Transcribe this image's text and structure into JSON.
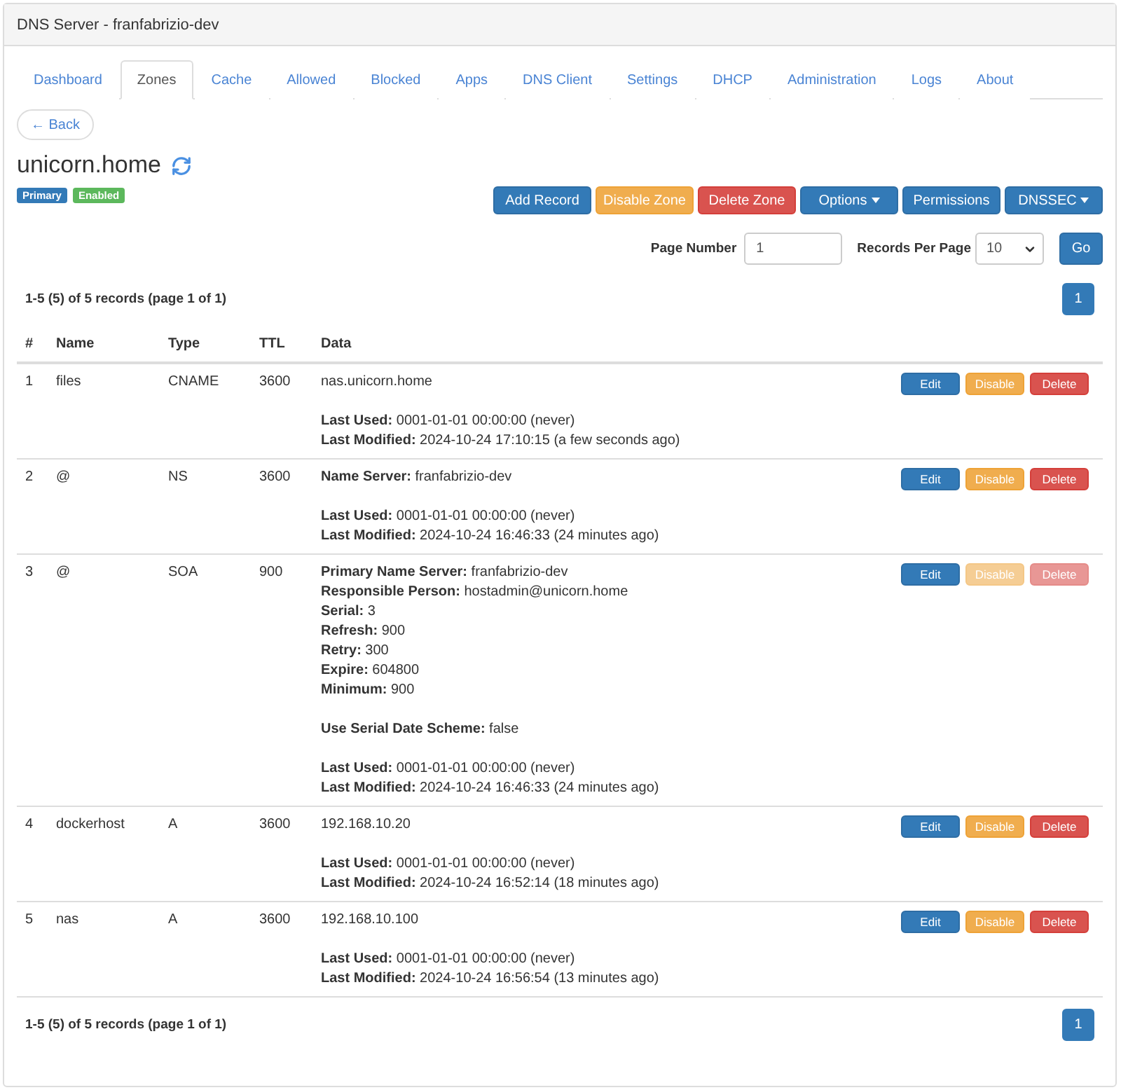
{
  "window": {
    "title": "DNS Server - franfabrizio-dev"
  },
  "tabs": [
    {
      "label": "Dashboard",
      "selected": false
    },
    {
      "label": "Zones",
      "selected": true
    },
    {
      "label": "Cache",
      "selected": false
    },
    {
      "label": "Allowed",
      "selected": false
    },
    {
      "label": "Blocked",
      "selected": false
    },
    {
      "label": "Apps",
      "selected": false
    },
    {
      "label": "DNS Client",
      "selected": false
    },
    {
      "label": "Settings",
      "selected": false
    },
    {
      "label": "DHCP",
      "selected": false
    },
    {
      "label": "Administration",
      "selected": false
    },
    {
      "label": "Logs",
      "selected": false
    },
    {
      "label": "About",
      "selected": false
    }
  ],
  "back_button": {
    "label": "← Back"
  },
  "zone": {
    "name": "unicorn.home",
    "badges": [
      {
        "label": "Primary",
        "color": "#337ab7"
      },
      {
        "label": "Enabled",
        "color": "#5cb85c"
      }
    ]
  },
  "zone_actions": [
    {
      "label": "Add Record",
      "kind": "primary",
      "dropdown": false
    },
    {
      "label": "Disable Zone",
      "kind": "warning",
      "dropdown": false
    },
    {
      "label": "Delete Zone",
      "kind": "danger",
      "dropdown": false
    },
    {
      "label": "Options",
      "kind": "primary",
      "dropdown": true
    },
    {
      "label": "Permissions",
      "kind": "primary",
      "dropdown": false
    },
    {
      "label": "DNSSEC",
      "kind": "primary",
      "dropdown": true
    }
  ],
  "paging_form": {
    "page_number": {
      "label": "Page Number",
      "value": "1"
    },
    "records_per_page": {
      "label": "Records Per Page",
      "value": "10"
    },
    "go_button": "Go"
  },
  "top_pager": {
    "summary": "1-5 (5) of 5 records (page 1 of 1)",
    "pages": [
      {
        "label": "1",
        "selected": true
      }
    ]
  },
  "table": {
    "columns": [
      "#",
      "Name",
      "Type",
      "TTL",
      "Data"
    ],
    "rows": [
      {
        "index": "1",
        "name": "files",
        "type": "CNAME",
        "ttl": "3600",
        "data_blocks": [
          [
            "nas.unicorn.home"
          ],
          [
            "**Last Used:** 0001-01-01 00:00:00 (never)",
            "**Last Modified:** 2024-10-24 17:10:15 (a few seconds ago)"
          ]
        ],
        "actions": [
          {
            "label": "Edit",
            "kind": "primary",
            "disabled": false
          },
          {
            "label": "Disable",
            "kind": "warning",
            "disabled": false
          },
          {
            "label": "Delete",
            "kind": "danger",
            "disabled": false
          }
        ]
      },
      {
        "index": "2",
        "name": "@",
        "type": "NS",
        "ttl": "3600",
        "data_blocks": [
          [
            "**Name Server:** franfabrizio-dev"
          ],
          [
            "**Last Used:** 0001-01-01 00:00:00 (never)",
            "**Last Modified:** 2024-10-24 16:46:33 (24 minutes ago)"
          ]
        ],
        "actions": [
          {
            "label": "Edit",
            "kind": "primary",
            "disabled": false
          },
          {
            "label": "Disable",
            "kind": "warning",
            "disabled": false
          },
          {
            "label": "Delete",
            "kind": "danger",
            "disabled": false
          }
        ]
      },
      {
        "index": "3",
        "name": "@",
        "type": "SOA",
        "ttl": "900",
        "data_blocks": [
          [
            "**Primary Name Server:** franfabrizio-dev",
            "**Responsible Person:** hostadmin@unicorn.home",
            "**Serial:** 3",
            "**Refresh:** 900",
            "**Retry:** 300",
            "**Expire:** 604800",
            "**Minimum:** 900"
          ],
          [
            "**Use Serial Date Scheme:** false"
          ],
          [
            "**Last Used:** 0001-01-01 00:00:00 (never)",
            "**Last Modified:** 2024-10-24 16:46:33 (24 minutes ago)"
          ]
        ],
        "actions": [
          {
            "label": "Edit",
            "kind": "primary",
            "disabled": false
          },
          {
            "label": "Disable",
            "kind": "warning",
            "disabled": true
          },
          {
            "label": "Delete",
            "kind": "danger",
            "disabled": true
          }
        ]
      },
      {
        "index": "4",
        "name": "dockerhost",
        "type": "A",
        "ttl": "3600",
        "data_blocks": [
          [
            "192.168.10.20"
          ],
          [
            "**Last Used:** 0001-01-01 00:00:00 (never)",
            "**Last Modified:** 2024-10-24 16:52:14 (18 minutes ago)"
          ]
        ],
        "actions": [
          {
            "label": "Edit",
            "kind": "primary",
            "disabled": false
          },
          {
            "label": "Disable",
            "kind": "warning",
            "disabled": false
          },
          {
            "label": "Delete",
            "kind": "danger",
            "disabled": false
          }
        ]
      },
      {
        "index": "5",
        "name": "nas",
        "type": "A",
        "ttl": "3600",
        "data_blocks": [
          [
            "192.168.10.100"
          ],
          [
            "**Last Used:** 0001-01-01 00:00:00 (never)",
            "**Last Modified:** 2024-10-24 16:56:54 (13 minutes ago)"
          ]
        ],
        "actions": [
          {
            "label": "Edit",
            "kind": "primary",
            "disabled": false
          },
          {
            "label": "Disable",
            "kind": "warning",
            "disabled": false
          },
          {
            "label": "Delete",
            "kind": "danger",
            "disabled": false
          }
        ]
      }
    ]
  },
  "bottom_pager": {
    "summary": "1-5 (5) of 5 records (page 1 of 1)",
    "pages": [
      {
        "label": "1",
        "selected": true
      }
    ]
  }
}
